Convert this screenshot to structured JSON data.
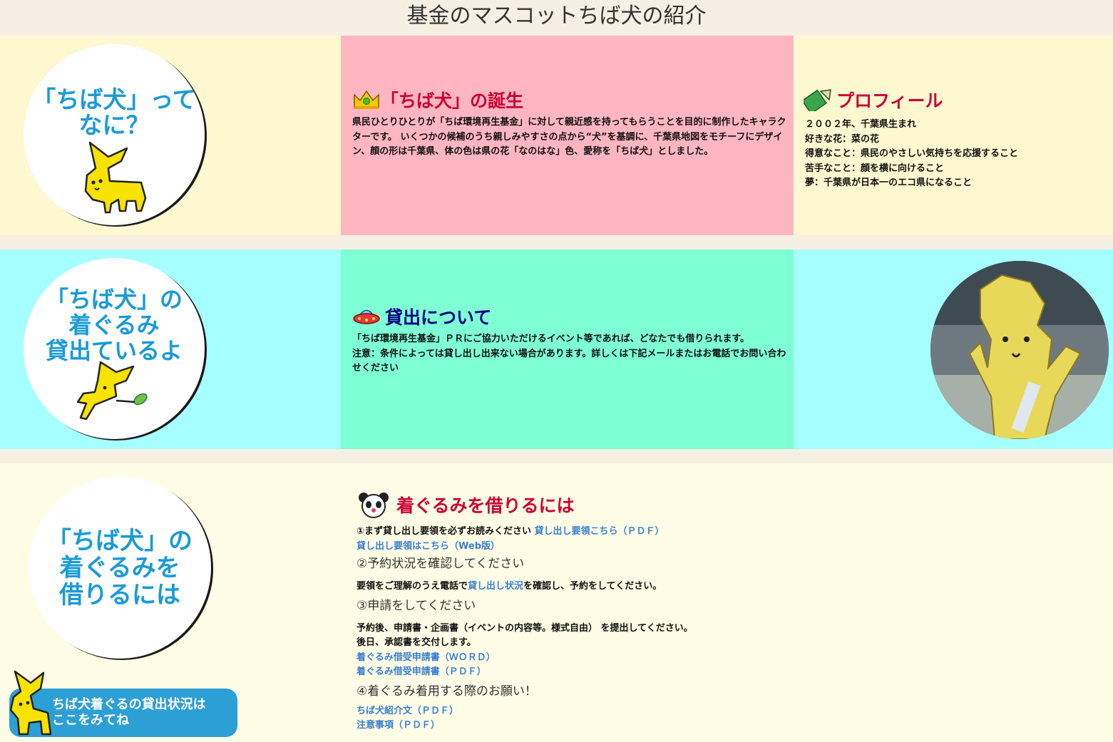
{
  "page": {
    "title": "基金のマスコットちば犬の紹介"
  },
  "section1": {
    "circle_text": "「ちば犬」って\nなに？",
    "birth": {
      "heading": "「ちば犬」の誕生",
      "text": "県民ひとりひとりが「ちば環境再生基金」に対して親近感を持ってもらうことを目的に制作したキャラクターです。 いくつかの候補のうち親しみやすさの点から“犬”を基調に、千葉県地図をモチーフにデザイン、顔の形は千葉県、体の色は県の花「なのはな」色、愛称を「ちば犬」としました。"
    },
    "profile": {
      "heading": "プロフィール",
      "lines": [
        "２００２年、千葉県生まれ",
        "好きな花：菜の花",
        "得意なこと：県民のやさしい気持ちを応援すること",
        "苦手なこと：顔を横に向けること",
        "夢：千葉県が日本一のエコ県になること"
      ]
    }
  },
  "section2": {
    "circle_text": "「ちば犬」の\n着ぐるみ\n貸出ているよ",
    "lending": {
      "heading": "貸出について",
      "lines": [
        "「ちば環境再生基金」ＰＲにご協力いただけるイベント等であれば、どなたでも借りられます。",
        "注意：条件によっては貸し出し出来ない場合があります。詳しくは下記メールまたはお電話でお問い合わせください"
      ]
    }
  },
  "section3": {
    "circle_text": "「ちば犬」の\n着ぐるみを\n借りるには",
    "banner_text": "ちば犬着ぐるの貸出状況は\nここをみてね",
    "rent": {
      "heading": "着ぐるみを借りるには",
      "step1_text": "①まず貸し出し要領を必ずお読みください",
      "step1_link_pdf": "貸し出し要領こちら（ＰＤＦ）",
      "step1_link_web": "貸し出し要領はこちら（Web版）",
      "step2": "②予約状況を確認してください",
      "step2_pre": "要領をご理解のうえ電話で",
      "step2_link": "貸し出し状況",
      "step2_post": "を確認し、予約をしてください。",
      "step3": "③申請をしてください",
      "step3_line1": "予約後、申請書・企画書（イベントの内容等。様式自由） を提出してください。",
      "step3_line2": "後日、承認書を交付します。",
      "step3_link_word": "着ぐるみ借受申請書（ＷＯＲＤ）",
      "step3_link_pdf": "着ぐるみ借受申請書（ＰＤＦ）",
      "step4": "④着ぐるみ着用する際のお願い！",
      "step4_link1": "ちば犬紹介文（ＰＤＦ）",
      "step4_link2": "注意事項（ＰＤＦ）"
    }
  },
  "colors": {
    "cream": "#fdf8d0",
    "pink": "#ffb6c1",
    "aqua": "#a6ffff",
    "mint": "#7fffd4",
    "light_cream": "#fffde6",
    "circle_text": "#1a9bd6",
    "heading_red": "#cc0033",
    "heading_navy": "#000080",
    "link_blue": "#3a7fd0",
    "mascot_yellow": "#f7e200"
  },
  "icons": [
    "crown-icon",
    "pencil-icon",
    "ufo-icon",
    "panda-icon",
    "chiba-dog-mascot-icon",
    "mascot-costume-photo"
  ]
}
